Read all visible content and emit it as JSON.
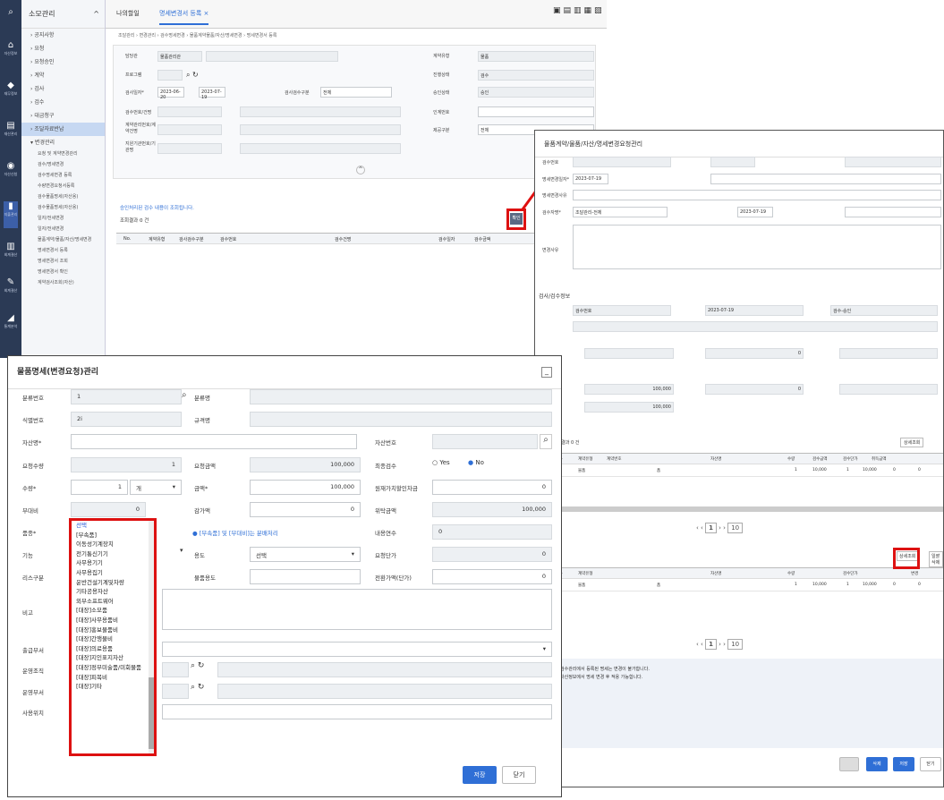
{
  "rail": [
    "검색",
    "자산정보",
    "재무정보",
    "재산관리",
    "자산신청",
    "지출관리",
    "회계결산",
    "통계분석"
  ],
  "sidebar": {
    "title": "소모관리",
    "items": [
      "공지사항",
      "요청",
      "요청승인",
      "계약",
      "검사",
      "검수",
      "대금청구",
      "조달자료반납",
      "변경관리"
    ],
    "subs": [
      "요청 및 계약변경관리",
      "검수/명세변경",
      "검수명세변경 등록",
      "수량변경요청서등록",
      "검수물품명세(자산용)",
      "검수물품명세(자산용)",
      "일자/전세변경",
      "일자/전세변경",
      "물품계약/물품/자산/명세변경",
      "명세변경서 등록",
      "명세변경서 조회",
      "명세변경서 확인",
      "계약검사조회(자산)",
      "계약검사조회(자산)"
    ]
  },
  "tabs": {
    "first": "나의할일",
    "active": "명세변경서 등록 ×"
  },
  "breadcrumb": "조달관리 › 변경관리 › 검수명세변경 › 물품계약물품/자산/명세변경 › 명세변경서 등록",
  "main_form": {
    "labels": [
      "담당관",
      "프로그램",
      "검사일자*",
      "검수번호/건명",
      "계약관리번호/계약건명",
      "지원기관번호/기관명",
      "계약유형",
      "진행상태",
      "승인상태",
      "인계번호",
      "제공구분"
    ],
    "range_from": "2023-06-20",
    "range_to": "2023-07-19",
    "gubun_label": "검사검수구분",
    "gubun_value": "전체",
    "dept": "물품관리관",
    "status1": "물품",
    "status2": "검수",
    "status3": "승인",
    "provide": "전체",
    "notice": "승인처리된 검수 내용이 조회됩니다.",
    "count": "조회결과 0 건",
    "cols": [
      "No.",
      "계약유형",
      "검사검수구분",
      "검수번호",
      "검수건명",
      "검수일자",
      "검수금액"
    ],
    "btn": "확인"
  },
  "win2": {
    "title": "물품계약/물품/자산/명세변경요청관리",
    "labels": [
      "검수번호",
      "명세변경일자*",
      "명세변경사유",
      "검수자명*",
      "변경사유"
    ],
    "date": "2023-07-19",
    "date2": "2023-07-19",
    "who": "조달관리-전체",
    "section": "검사/검수정보",
    "values": [
      "검수번호",
      "2023-07-19",
      "검수-승인"
    ],
    "grid_label": "조회결과 0 건",
    "grid_cols": [
      "No.",
      "계약유형",
      "계약번호",
      "자산명",
      "수량",
      "검수금액",
      "검수단가",
      "취득금액",
      "변경",
      "변경후"
    ],
    "row1": [
      "1",
      "물품",
      "품",
      "1",
      "10,000",
      "1",
      "10,000",
      "0",
      "0"
    ],
    "row2": [
      "1",
      "물품",
      "품",
      "1",
      "10,000",
      "1",
      "10,000",
      "0",
      "0"
    ],
    "footnotes": [
      "검수관리에서 등록된 명세는 변경이 불가합니다.",
      "자산정보에서 명세 변경 후 적용 가능합니다."
    ],
    "btns": [
      "삭제",
      "저장",
      "닫기"
    ],
    "search_btn": "상세조회",
    "bulk_btn": "일괄삭제",
    "pager": "1",
    "pagesize": "10",
    "amount1": "100,000",
    "amount2": "100,000",
    "amount3": "0"
  },
  "dialog": {
    "title": "물품명세(변경요청)관리",
    "labels": {
      "bunryu_no": "분류번호",
      "bunryu_name": "분류명",
      "sik_no": "식별번호",
      "gyugyeok": "규격명",
      "jasan_name": "자산명*",
      "jasan_no": "자산번호",
      "req_qty": "요청수량",
      "req_amt": "요청금액",
      "final": "최종검수",
      "qty": "수량*",
      "amount": "금액*",
      "discount": "원재가치할인차금",
      "buga": "부대비",
      "gamga": "감가액",
      "used": "위탁금액",
      "pumjong": "품종*",
      "durable": "내용연수",
      "func": "기능",
      "yongdo": "용도",
      "req_price": "요청단가",
      "lease": "리스구분",
      "goods_use": "물품용도",
      "final_price": "전환가액(단가)",
      "bigo": "비고",
      "dept1": "출급부서",
      "dept2": "운영조직",
      "dept3": "운영부서",
      "loc": "사용위치"
    },
    "values": {
      "bunryu_no": "1",
      "sik_no": "2i",
      "req_qty": "1",
      "req_amt": "100,000",
      "qty": "1",
      "unit": "개",
      "amount": "100,000",
      "discount": "0",
      "buga": "0",
      "gamga": "0",
      "used": "100,000",
      "durable": "0",
      "req_price": "0",
      "final_price": "0",
      "yongdo": "선택"
    },
    "radio_yes": "Yes",
    "radio_no": "No",
    "pumjong_note": "[부속품] 및 [부대비]는 분배처리",
    "btn_save": "저장",
    "btn_close": "닫기"
  },
  "dropdown": [
    "선택",
    "[부속품]",
    "이동성기계장치",
    "전기통신기기",
    "사무용기기",
    "사무용집기",
    "운반건설기계및차량",
    "기타공용자산",
    "외부소프트웨어",
    "[대장]소모품",
    "[대장]사무용품비",
    "[대장]홍보물품비",
    "[대장]간행물비",
    "[대장]의료용품",
    "[대장]지인표지자산",
    "[대장]정부미술품/미회물품",
    "[대장]피복비",
    "[대장]기타"
  ],
  "colors": {
    "rail": "#2b3a55",
    "accent": "#2f6fd6",
    "highlight": "#d11111"
  }
}
